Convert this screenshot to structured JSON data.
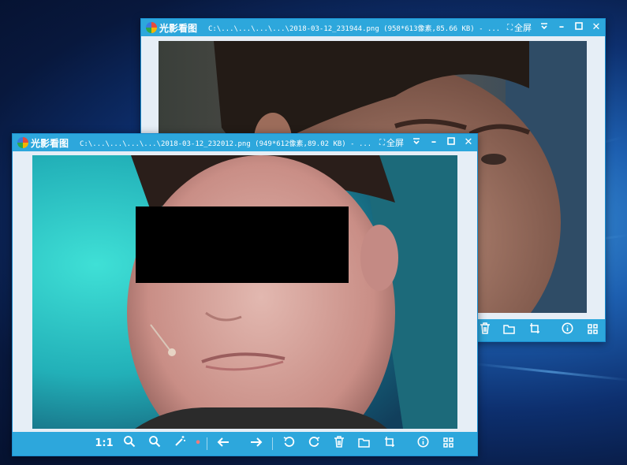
{
  "back_window": {
    "app_name": "光影看图",
    "file_info": "C:\\...\\...\\...\\...\\2018-03-12_231944.png (958*613像素,85.66 KB) - ...",
    "fullscreen_label": "全屏",
    "toolbar_visible": [
      "delete-icon",
      "open-folder-icon",
      "crop-icon",
      "info-icon",
      "grid-icon"
    ]
  },
  "front_window": {
    "app_name": "光影看图",
    "file_info": "C:\\...\\...\\...\\...\\2018-03-12_232012.png (949*612像素,89.02 KB) - ...",
    "fullscreen_label": "全屏",
    "toolbar": {
      "actual_size_label": "1:1",
      "tools": [
        "zoom-in-icon",
        "zoom-out-icon",
        "magic-wand-icon",
        "prev-icon",
        "next-icon",
        "rotate-left-icon",
        "rotate-right-icon",
        "delete-icon",
        "open-folder-icon",
        "crop-icon",
        "info-icon",
        "grid-icon"
      ]
    }
  },
  "colors": {
    "accent": "#2da7dc",
    "frame": "#e6eef6",
    "desktop": "#0d2f6e"
  }
}
